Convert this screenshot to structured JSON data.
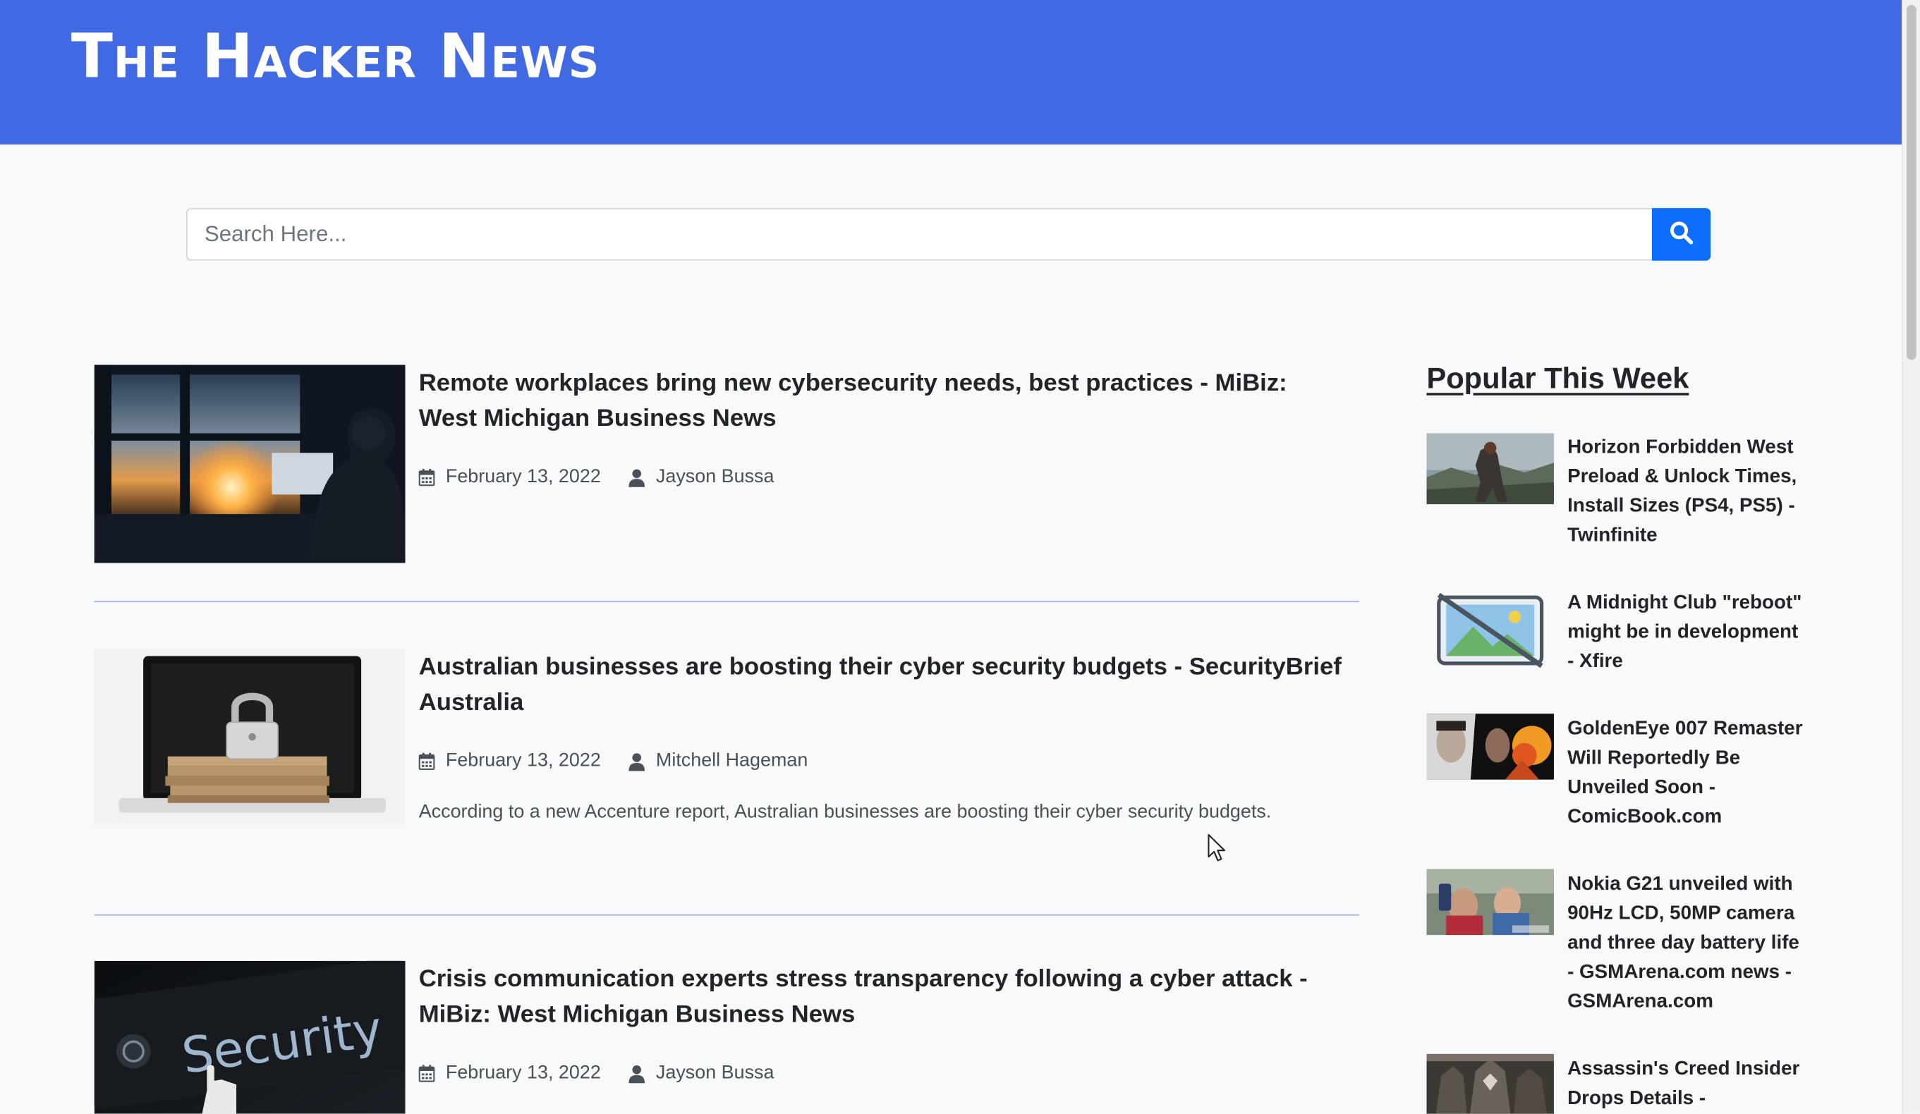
{
  "header": {
    "brand": "The Hacker News",
    "background_color": "#4169e1"
  },
  "search": {
    "placeholder": "Search Here...",
    "value": "",
    "button_icon": "search-icon",
    "button_color": "#0d6efd"
  },
  "articles": [
    {
      "title": "Remote workplaces bring new cybersecurity needs, best practices - MiBiz: West Michigan Business News",
      "date": "February 13, 2022",
      "author": "Jayson Bussa",
      "excerpt": "",
      "image": "person-at-window-sunset-photo"
    },
    {
      "title": "Australian businesses are boosting their cyber security budgets - SecurityBrief Australia",
      "date": "February 13, 2022",
      "author": "Mitchell Hageman",
      "excerpt": "According to a new Accenture report, Australian businesses are boosting their cyber security budgets.",
      "image": "padlock-on-cash-laptop-photo"
    },
    {
      "title": "Crisis communication experts stress transparency following a cyber attack - MiBiz: West Michigan Business News",
      "date": "February 13, 2022",
      "author": "Jayson Bussa",
      "excerpt": "",
      "image": "security-keyboard-photo",
      "image_text": "Security"
    }
  ],
  "sidebar": {
    "heading": "Popular This Week",
    "items": [
      {
        "title": "Horizon Forbidden West Preload & Unlock Times, Install Sizes (PS4, PS5) - Twinfinite",
        "image": "horizon-game-photo"
      },
      {
        "title": "A Midnight Club \"reboot\" might be in development - Xfire",
        "image": "no-image-placeholder-icon"
      },
      {
        "title": "GoldenEye 007 Remaster Will Reportedly Be Unveiled Soon - ComicBook.com",
        "image": "goldeneye-poster-photo"
      },
      {
        "title": "Nokia G21 unveiled with 90Hz LCD, 50MP camera and three day battery life - GSMArena.com news - GSMArena.com",
        "image": "nokia-selfie-photo"
      },
      {
        "title": "Assassin's Creed Insider Drops Details -",
        "image": "assassins-creed-photo"
      }
    ]
  },
  "icons": {
    "date": "calendar-icon",
    "author": "user-icon"
  }
}
